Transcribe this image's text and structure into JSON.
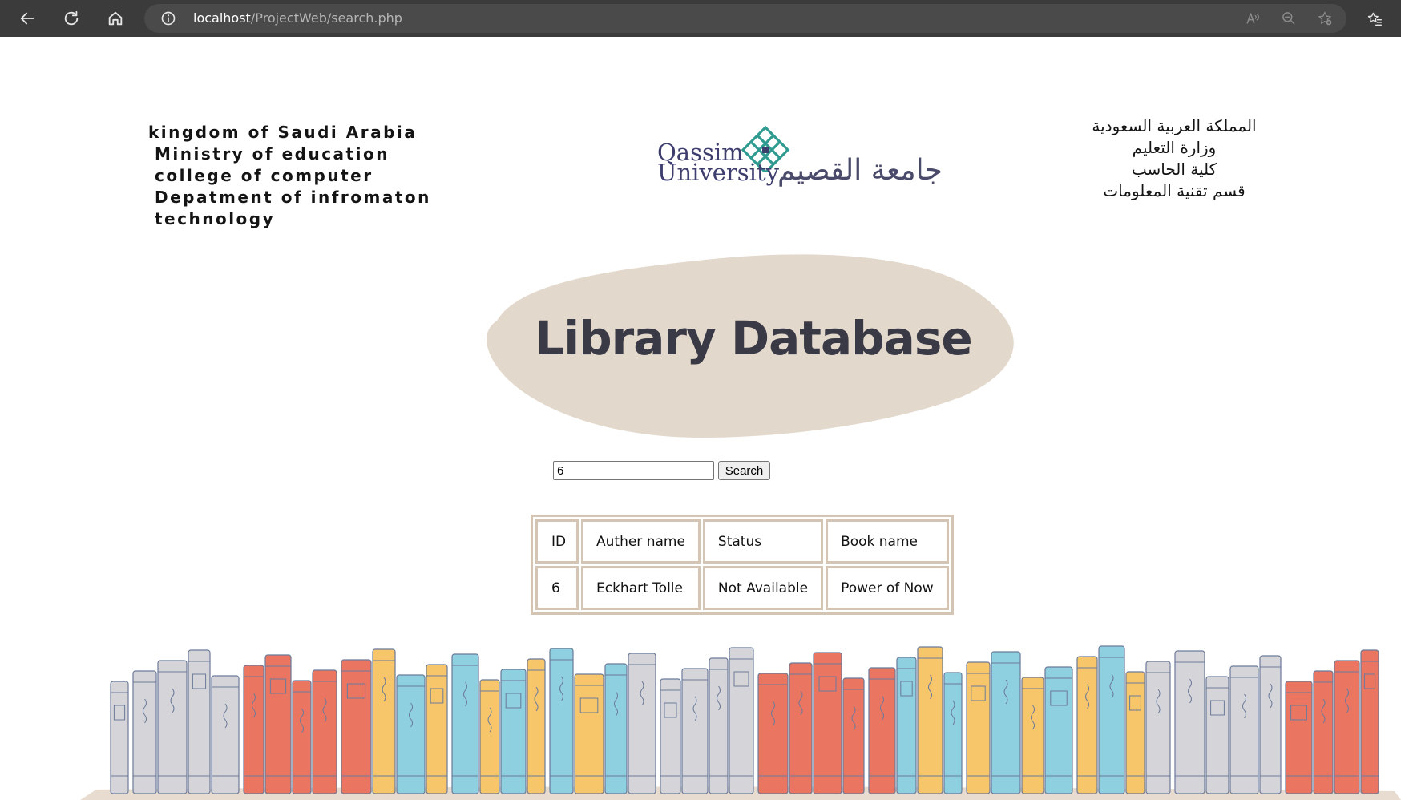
{
  "browser": {
    "url_host": "localhost",
    "url_path": "/ProjectWeb/search.php"
  },
  "header": {
    "left_lines": [
      "kingdom of Saudi Arabia",
      "Ministry of education",
      "college of computer",
      "Depatment of infromaton",
      "technology"
    ],
    "right_lines": [
      "المملكة العربية السعودية",
      "وزارة التعليم",
      "كلية الحاسب",
      "قسم تقنية المعلومات"
    ],
    "logo": {
      "latin_line1": "Qassim",
      "latin_line2": "University",
      "arabic": "جامعة القصيم"
    }
  },
  "title": "Library Database",
  "search": {
    "value": "6",
    "button_label": "Search"
  },
  "table": {
    "headers": [
      "ID",
      "Auther name",
      "Status",
      "Book name"
    ],
    "rows": [
      [
        "6",
        "Eckhart Tolle",
        "Not Available",
        "Power of Now"
      ]
    ]
  },
  "colors": {
    "chrome_bg": "#3b3b3b",
    "blob": "#e3d8cc",
    "table_border": "#d3c4b4",
    "logo_green": "#2f9a8f",
    "title_text": "#3a3a46"
  }
}
